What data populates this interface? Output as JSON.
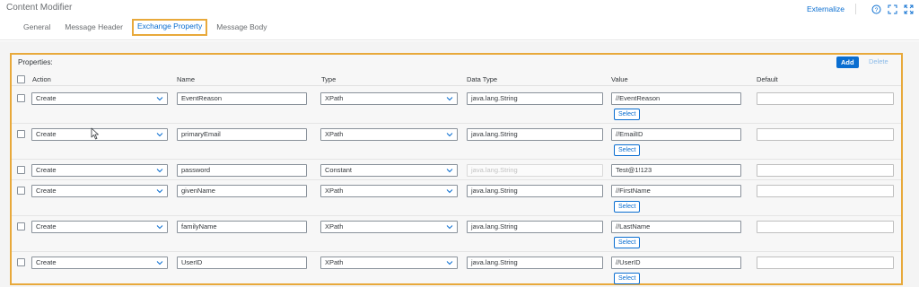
{
  "window": {
    "title": "Content Modifier"
  },
  "header": {
    "externalize_label": "Externalize"
  },
  "tabs": [
    {
      "label": "General",
      "selected": false
    },
    {
      "label": "Message Header",
      "selected": false
    },
    {
      "label": "Exchange Property",
      "selected": true
    },
    {
      "label": "Message Body",
      "selected": false
    }
  ],
  "properties": {
    "label": "Properties:",
    "add_label": "Add",
    "delete_label": "Delete",
    "columns": [
      "Action",
      "Name",
      "Type",
      "Data Type",
      "Value",
      "Default"
    ],
    "rows": [
      {
        "action": "Create",
        "name": "EventReason",
        "type": "XPath",
        "data_type": "java.lang.String",
        "value": "//EventReason",
        "select_label": "Select",
        "default": ""
      },
      {
        "action": "Create",
        "name": "primaryEmail",
        "type": "XPath",
        "data_type": "java.lang.String",
        "value": "//EmailID",
        "select_label": "Select",
        "default": ""
      },
      {
        "action": "Create",
        "name": "password",
        "type": "Constant",
        "data_type": "java.lang.String",
        "value": "Test@1!123",
        "select_label": "",
        "default": ""
      },
      {
        "action": "Create",
        "name": "givenName",
        "type": "XPath",
        "data_type": "java.lang.String",
        "value": "//FirstName",
        "select_label": "Select",
        "default": ""
      },
      {
        "action": "Create",
        "name": "familyName",
        "type": "XPath",
        "data_type": "java.lang.String",
        "value": "//LastName",
        "select_label": "Select",
        "default": ""
      },
      {
        "action": "Create",
        "name": "UserID",
        "type": "XPath",
        "data_type": "java.lang.String",
        "value": "//UserID",
        "select_label": "Select",
        "default": ""
      }
    ]
  },
  "colors": {
    "accent": "#0a6ed1",
    "highlight": "#e8a93b"
  },
  "icons": [
    "help-icon",
    "expand-icon",
    "fullscreen-icon",
    "chevron-down-icon"
  ]
}
